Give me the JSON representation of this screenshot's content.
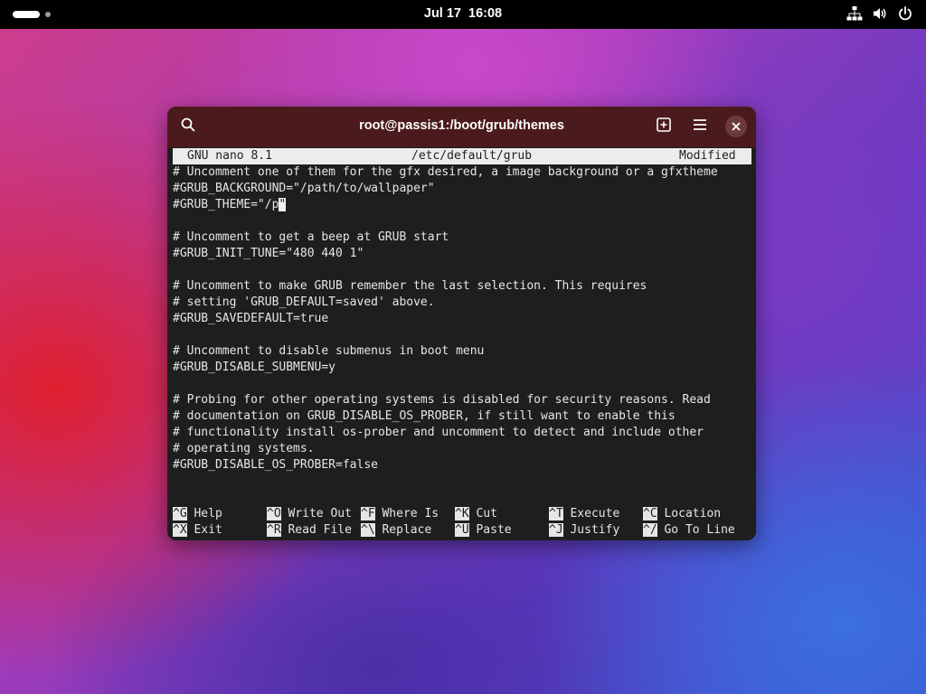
{
  "topbar": {
    "date": "Jul 17",
    "time": "16:08"
  },
  "window": {
    "title": "root@passis1:/boot/grub/themes"
  },
  "nano": {
    "version": "GNU nano 8.1",
    "filename": "/etc/default/grub",
    "status": "Modified"
  },
  "editor": {
    "lines": [
      "# Uncomment one of them for the gfx desired, a image background or a gfxtheme",
      "#GRUB_BACKGROUND=\"/path/to/wallpaper\"",
      "#GRUB_THEME=\"/p",
      "",
      "# Uncomment to get a beep at GRUB start",
      "#GRUB_INIT_TUNE=\"480 440 1\"",
      "",
      "# Uncomment to make GRUB remember the last selection. This requires",
      "# setting 'GRUB_DEFAULT=saved' above.",
      "#GRUB_SAVEDEFAULT=true",
      "",
      "# Uncomment to disable submenus in boot menu",
      "#GRUB_DISABLE_SUBMENU=y",
      "",
      "# Probing for other operating systems is disabled for security reasons. Read",
      "# documentation on GRUB_DISABLE_OS_PROBER, if still want to enable this",
      "# functionality install os-prober and uncomment to detect and include other",
      "# operating systems.",
      "#GRUB_DISABLE_OS_PROBER=false"
    ],
    "cursor_char": "\""
  },
  "shortcuts": {
    "row1": [
      {
        "key": "^G",
        "label": "Help"
      },
      {
        "key": "^O",
        "label": "Write Out"
      },
      {
        "key": "^F",
        "label": "Where Is"
      },
      {
        "key": "^K",
        "label": "Cut"
      },
      {
        "key": "^T",
        "label": "Execute"
      },
      {
        "key": "^C",
        "label": "Location"
      }
    ],
    "row2": [
      {
        "key": "^X",
        "label": "Exit"
      },
      {
        "key": "^R",
        "label": "Read File"
      },
      {
        "key": "^\\",
        "label": "Replace"
      },
      {
        "key": "^U",
        "label": "Paste"
      },
      {
        "key": "^J",
        "label": "Justify"
      },
      {
        "key": "^/",
        "label": "Go To Line"
      }
    ]
  },
  "icons": {
    "activities": "activities-indicator",
    "network": "network-icon",
    "volume": "volume-icon",
    "power": "power-icon",
    "search": "search-icon",
    "new_tab": "new-tab-icon",
    "menu": "menu-icon",
    "close": "close-icon"
  },
  "colors": {
    "headerbar": "#4a1a1d",
    "terminal_bg": "#1e1e1e",
    "terminal_fg": "#e6e6e6"
  }
}
